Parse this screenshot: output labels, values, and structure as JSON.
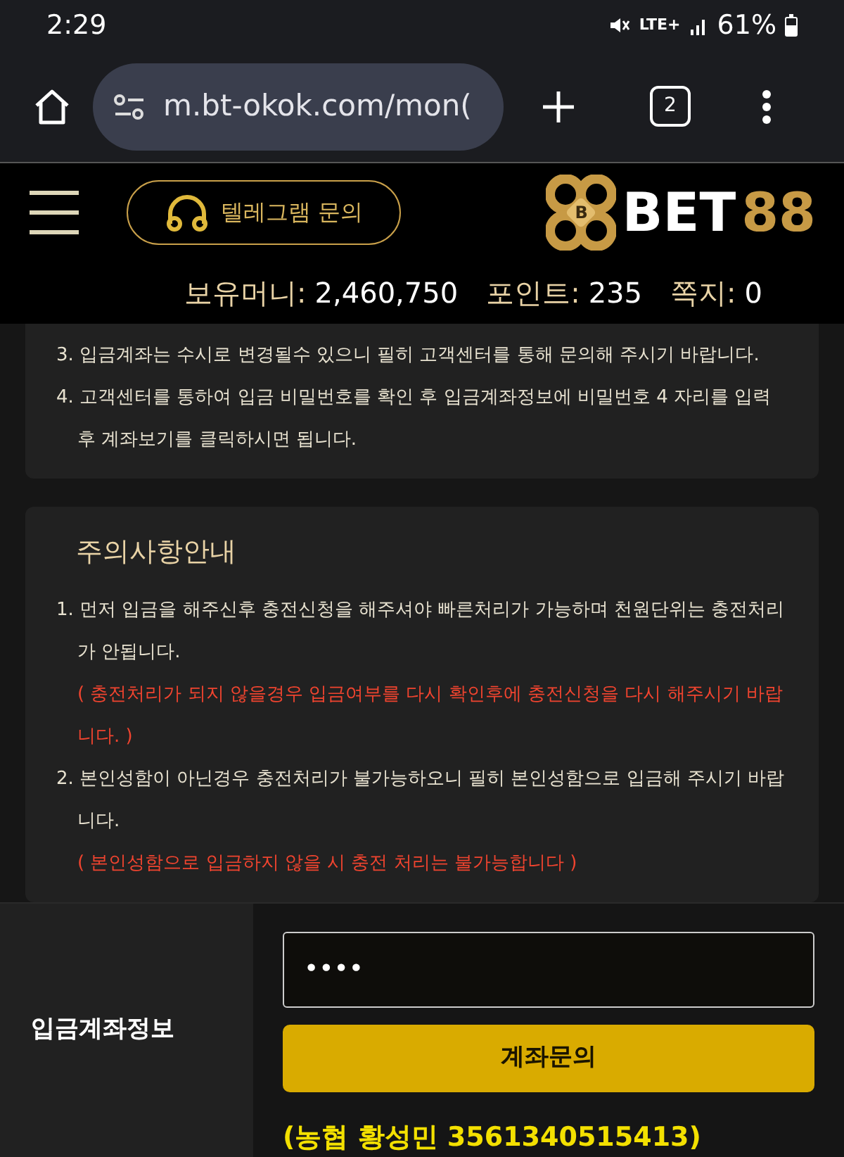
{
  "status_bar": {
    "time": "2:29",
    "network": "LTE+",
    "battery": "61%"
  },
  "browser": {
    "url": "m.bt-okok.com/mon(",
    "tab_count": "2"
  },
  "header": {
    "telegram_button": "텔레그램 문의",
    "logo_mark": "B",
    "logo_word": "BET",
    "logo_number": "88"
  },
  "balances": [
    {
      "label": "보유머니:",
      "value": "2,460,750"
    },
    {
      "label": "포인트:",
      "value": "235"
    },
    {
      "label": "쪽지:",
      "value": "0"
    }
  ],
  "notice": {
    "items": [
      {
        "kind": "normal",
        "text": "3. 입금계좌는 수시로 변경될수 있으니 필히 고객센터를 통해 문의해 주시기 바랍니다."
      },
      {
        "kind": "normal",
        "text": "4. 고객센터를 통하여 입금 비밀번호를 확인 후 입금계좌정보에 비밀번호 4 자리를 입력후 계좌보기를 클릭하시면 됩니다."
      }
    ]
  },
  "caution": {
    "title": "주의사항안내",
    "items": [
      {
        "kind": "normal",
        "text": "1. 먼저 입금을 해주신후 충전신청을 해주셔야 빠른처리가 가능하며 천원단위는 충전처리가 안됩니다."
      },
      {
        "kind": "warning",
        "text": "( 충전처리가 되지 않을경우 입금여부를 다시 확인후에 충전신청을 다시 해주시기 바랍니다. )"
      },
      {
        "kind": "normal",
        "text": "2. 본인성함이 아닌경우 충전처리가 불가능하오니 필히 본인성함으로 입금해 주시기 바랍니다."
      },
      {
        "kind": "warning",
        "text": "( 본인성함으로 입금하지 않을 시 충전 처리는 불가능합니다 )"
      }
    ]
  },
  "account_form": {
    "label": "입금계좌정보",
    "password": "••••",
    "button": "계좌문의",
    "account_info": "(농협 황성민 3561340515413)"
  }
}
